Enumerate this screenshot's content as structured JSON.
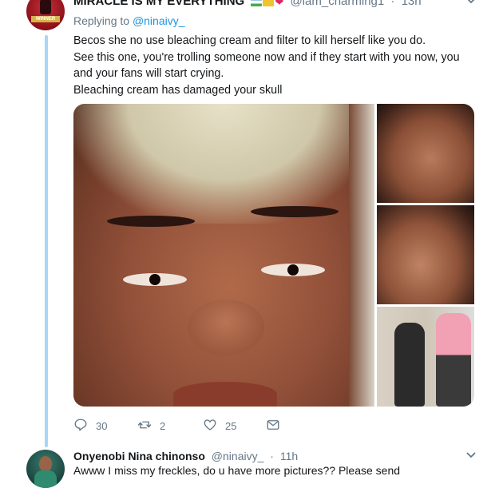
{
  "tweet1": {
    "display_name": "MIRACLE IS MY EVERYTHING",
    "handle": "@iam_charming1",
    "time": "13h",
    "replying_label": "Replying to",
    "replying_to": "@ninaivy_",
    "avatar_text": "WINNER",
    "text_lines": [
      "Becos she no use bleaching cream and filter to kill herself like you do.",
      "See this one, you're trolling someone now and if they start with you now, you and your fans will start crying.",
      "Bleaching cream has damaged your skull"
    ],
    "actions": {
      "replies": "30",
      "retweets": "2",
      "likes": "25"
    }
  },
  "tweet2": {
    "display_name": "Onyenobi Nina chinonso",
    "handle": "@ninaivy_",
    "time": "11h",
    "text": "Awww I miss my freckles, do u have more pictures?? Please send"
  },
  "colors": {
    "accent": "#1b95e0",
    "muted": "#657786",
    "thread_line": "#a6d7f5",
    "heart": "#e0245e"
  },
  "icons": [
    "chevron-down-icon",
    "reply-icon",
    "retweet-icon",
    "like-icon",
    "dm-icon"
  ]
}
